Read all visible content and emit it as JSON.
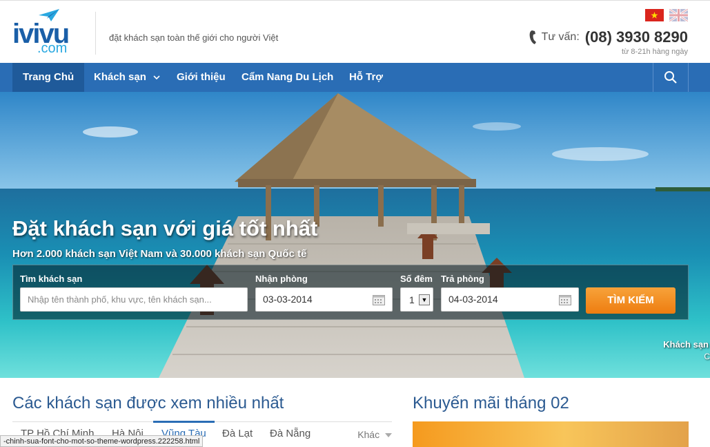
{
  "header": {
    "logo_main": "ivivu",
    "logo_sub": ".com",
    "tagline": "đặt khách sạn toàn thế giới cho người Việt",
    "hotline_label": "Tư vấn:",
    "hotline_number": "(08) 3930 8290",
    "hotline_hours": "từ 8-21h hàng ngày",
    "flags": [
      "vietnam-flag-icon",
      "uk-flag-icon"
    ]
  },
  "nav": {
    "items": [
      "Trang Chủ",
      "Khách sạn",
      "Giới thiệu",
      "Cẩm Nang Du Lịch",
      "Hỗ Trợ"
    ],
    "active": "Trang Chủ"
  },
  "hero": {
    "title": "Đặt khách sạn với giá tốt nhất",
    "subtitle": "Hơn 2.000 khách sạn Việt Nam và 30.000 khách sạn Quốc tế",
    "side_text": "Khách sạn",
    "side_text2": "C"
  },
  "search": {
    "hotel_label": "Tìm khách sạn",
    "hotel_placeholder": "Nhập tên thành phố, khu vực, tên khách sạn...",
    "checkin_label": "Nhận phòng",
    "checkin_value": "03-03-2014",
    "nights_label": "Số đêm",
    "nights_value": "1",
    "checkout_label": "Trả phòng",
    "checkout_value": "04-03-2014",
    "button": "TÌM KIẾM"
  },
  "popular": {
    "title": "Các khách sạn được xem nhiều nhất",
    "tabs": [
      "TP Hồ Chí Minh",
      "Hà Nội",
      "Vũng Tàu",
      "Đà Lạt",
      "Đà Nẵng"
    ],
    "active_tab": "Vũng Tàu",
    "more": "Khác"
  },
  "promo": {
    "title": "Khuyến mãi tháng 02"
  },
  "status_url": "-chinh-sua-font-cho-mot-so-theme-wordpress.222258.html",
  "colors": {
    "brand_blue": "#2a6db5",
    "nav_active": "#1f5a9a",
    "title_blue": "#2b5a91",
    "button_orange": "#f28a1a"
  }
}
